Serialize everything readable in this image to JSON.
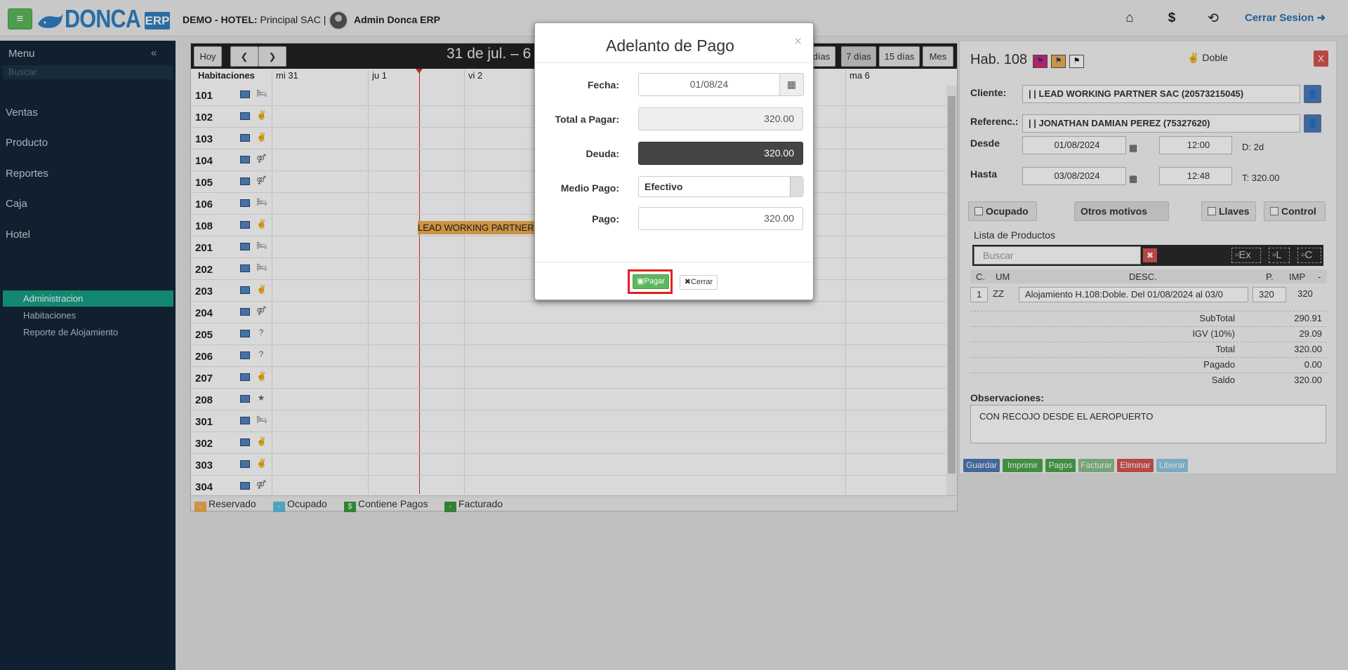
{
  "header": {
    "company_prefix": "DEMO - HOTEL:",
    "company_name": "Principal SAC |",
    "user_name": "Admin Donca ERP",
    "logo_text": "DONCA",
    "logo_badge": "ERP",
    "logout_label": "Cerrar Sesion",
    "icons": [
      "home-icon",
      "dollar-icon",
      "lock-icon"
    ]
  },
  "sidebar": {
    "title": "Menu",
    "search_placeholder": "Buscar",
    "items": [
      "Ventas",
      "Producto",
      "Reportes",
      "Caja",
      "Hotel"
    ],
    "subitems": [
      "Administracion",
      "Habitaciones",
      "Reporte de Alojamiento"
    ]
  },
  "calendar": {
    "today_label": "Hoy",
    "title": "31 de jul. – 6",
    "views": [
      "días",
      "7 días",
      "15 días",
      "Mes"
    ],
    "rooms_header": "Habitaciones",
    "days": [
      "mi 31",
      "ju 1",
      "vi 2",
      "ma 6"
    ],
    "rooms": [
      {
        "num": "101",
        "type": "bed"
      },
      {
        "num": "102",
        "type": "peace"
      },
      {
        "num": "103",
        "type": "peace"
      },
      {
        "num": "104",
        "type": "couple"
      },
      {
        "num": "105",
        "type": "couple"
      },
      {
        "num": "106",
        "type": "bed"
      },
      {
        "num": "108",
        "type": "peace"
      },
      {
        "num": "201",
        "type": "bed"
      },
      {
        "num": "202",
        "type": "bed"
      },
      {
        "num": "203",
        "type": "peace"
      },
      {
        "num": "204",
        "type": "couple"
      },
      {
        "num": "205",
        "type": "?"
      },
      {
        "num": "206",
        "type": "?"
      },
      {
        "num": "207",
        "type": "peace"
      },
      {
        "num": "208",
        "type": "star"
      },
      {
        "num": "301",
        "type": "bed"
      },
      {
        "num": "302",
        "type": "peace"
      },
      {
        "num": "303",
        "type": "peace"
      },
      {
        "num": "304",
        "type": "couple"
      }
    ],
    "booking_label": "LEAD WORKING PARTNER",
    "legend": [
      {
        "label": "Reservado",
        "color": "#f0ad4e",
        "mark": "-"
      },
      {
        "label": "Ocupado",
        "color": "#5bc0de",
        "mark": "-"
      },
      {
        "label": "Contiene Pagos",
        "color": "#3a9a3a",
        "mark": "$"
      },
      {
        "label": "Facturado",
        "color": "#3a9a3a",
        "mark": "-"
      }
    ]
  },
  "room_panel": {
    "title": "Hab. 108",
    "room_type": "Doble",
    "close_label": "X",
    "cliente_label": "Cliente:",
    "cliente_value": "| | LEAD WORKING PARTNER SAC (20573215045)",
    "referenc_label": "Referenc.:",
    "referenc_value": "| | JONATHAN DAMIAN PEREZ (75327620)",
    "desde_label": "Desde",
    "desde_date": "01/08/2024",
    "desde_time": "12:00",
    "days_info": "D: 2d",
    "hasta_label": "Hasta",
    "hasta_date": "03/08/2024",
    "hasta_time": "12:48",
    "total_info": "T: 320.00",
    "ocupado_label": "Ocupado",
    "otros_label": "Otros motivos",
    "llaves_label": "Llaves",
    "control_label": "Control",
    "productos_label": "Lista de Productos",
    "buscar_placeholder": "Buscar",
    "filter_labels": [
      "Ex",
      "L",
      "C"
    ],
    "cols": {
      "c": "C.",
      "um": "UM",
      "desc": "DESC.",
      "p": "P.",
      "imp": "IMP",
      "extra": "-"
    },
    "line": {
      "qty": "1",
      "um": "ZZ",
      "desc": "Alojamiento H.108:Doble. Del 01/08/2024 al 03/0",
      "price": "320",
      "imp": "320"
    },
    "totals": [
      {
        "label": "SubTotal",
        "value": "290.91"
      },
      {
        "label": "IGV (10%)",
        "value": "29.09"
      },
      {
        "label": "Total",
        "value": "320.00"
      },
      {
        "label": "Pagado",
        "value": "0.00"
      },
      {
        "label": "Saldo",
        "value": "320.00"
      }
    ],
    "obs_label": "Observaciones:",
    "obs_value": "CON RECOJO DESDE EL AEROPUERTO",
    "actions": [
      {
        "label": "Guardar",
        "color": "#4f7ab5"
      },
      {
        "label": "Imprimir",
        "color": "#4aa74a"
      },
      {
        "label": "Pagos",
        "color": "#4aa74a"
      },
      {
        "label": "Facturar",
        "color": "#8cc08c"
      },
      {
        "label": "Eliminar",
        "color": "#d9534f"
      },
      {
        "label": "Liberar",
        "color": "#8fc9e0"
      }
    ]
  },
  "modal": {
    "title": "Adelanto de Pago",
    "close_glyph": "×",
    "fecha_label": "Fecha:",
    "fecha_value": "01/08/24",
    "total_label": "Total a Pagar:",
    "total_value": "320.00",
    "deuda_label": "Deuda:",
    "deuda_value": "320.00",
    "medio_label": "Medio Pago:",
    "medio_value": "Efectivo",
    "pago_label": "Pago:",
    "pago_value": "320.00",
    "pagar_label": "Pagar",
    "cerrar_label": "Cerrar"
  }
}
